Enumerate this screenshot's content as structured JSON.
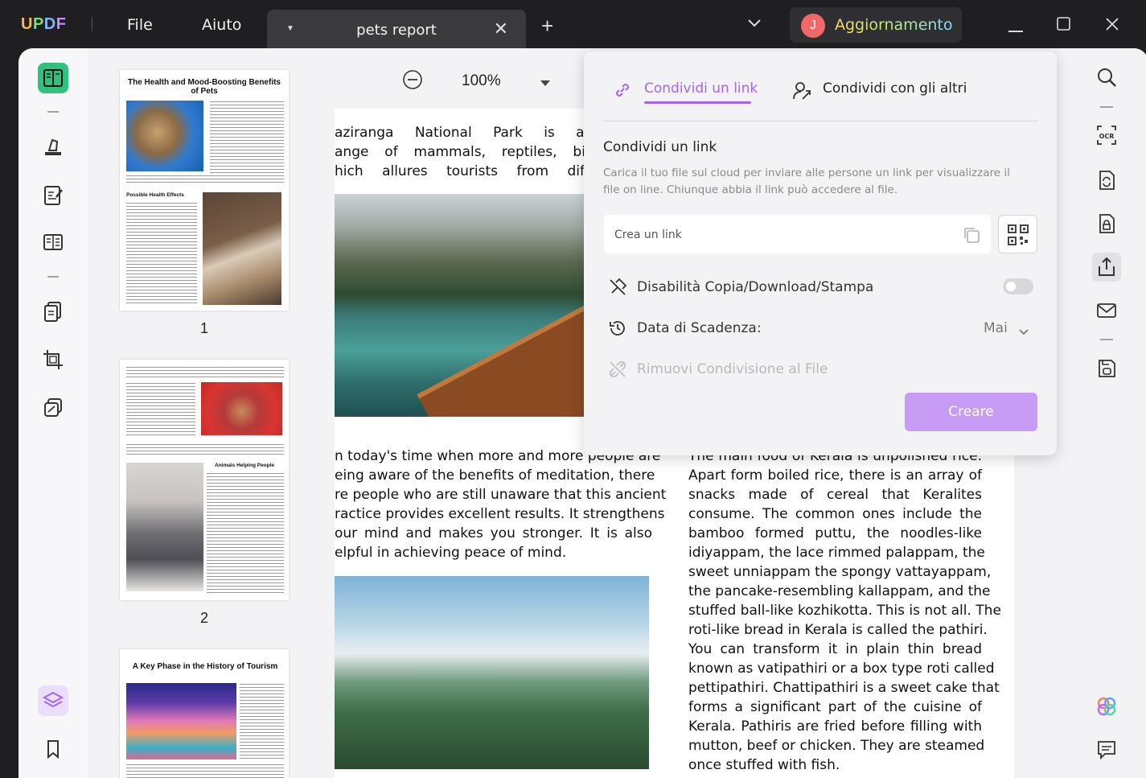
{
  "app": {
    "logo": "UPDF",
    "menu": [
      "File",
      "Aiuto"
    ]
  },
  "tab": {
    "title": "pets report"
  },
  "account": {
    "avatar_letter": "J",
    "upgrade_label": "Aggiornamento"
  },
  "thumbnails": {
    "pages": [
      {
        "number": "1",
        "title": "The Health and Mood-Boosting Benefits of Pets",
        "section": "Possible Health Effects"
      },
      {
        "number": "2",
        "section": "Animals Helping People"
      },
      {
        "title": "A Key Phase in the History of Tourism"
      }
    ]
  },
  "viewer": {
    "zoom": "100%",
    "para1": [
      "aziranga National Park is a showcase",
      "ange of mammals, reptiles, birds and v",
      "hich allures tourists from different loca"
    ],
    "para2": [
      "n today's time when more and more people are",
      "eing aware of the benefits of meditation, there",
      "re people who are still unaware that this ancient",
      "ractice provides excellent results. It strengthens",
      "our mind and makes you stronger. It is also",
      "elpful in achieving peace of mind."
    ],
    "para3": [
      "The main food of Kerala is unpolished rice.",
      "Apart form boiled rice, there is an array of",
      "snacks made of cereal that Keralites",
      "consume. The common ones include the",
      "bamboo formed puttu, the noodles-like",
      "idiyappam, the lace rimmed palappam, the",
      "sweet unniappam the spongy vattayappam,",
      "the pancake-resembling kallappam, and the",
      "stuffed ball-like kozhikotta. This is not all. The",
      "roti-like bread in Kerala is called the pathiri.",
      "You can transform it in plain thin bread",
      "known as vatipathiri or a box type roti called",
      "pettipathiri. Chattipathiri is a sweet cake that",
      "forms a significant part of the cuisine of",
      "Kerala. Pathiris are fried before filling with",
      "mutton, beef or chicken. They are steamed",
      "once stuffed with fish."
    ]
  },
  "share_popup": {
    "tab_link": "Condividi un link",
    "tab_others": "Condividi con gli altri",
    "section_title": "Condividi un link",
    "description": "Carica il tuo file sul cloud per inviare alle persone un link per visualizzare il file on line. Chiunque abbia il link può accedere al file.",
    "link_placeholder": "Crea un link",
    "disable_label": "Disabilità Copia/Download/Stampa",
    "disable_enabled": false,
    "expiry_label": "Data di Scadenza:",
    "expiry_value": "Mai",
    "remove_label": "Rimuovi Condivisione al File",
    "create_button": "Creare"
  },
  "colors": {
    "accent": "#a366f2",
    "create_button": "#c79cf5",
    "titlebar": "#1f1f22"
  }
}
